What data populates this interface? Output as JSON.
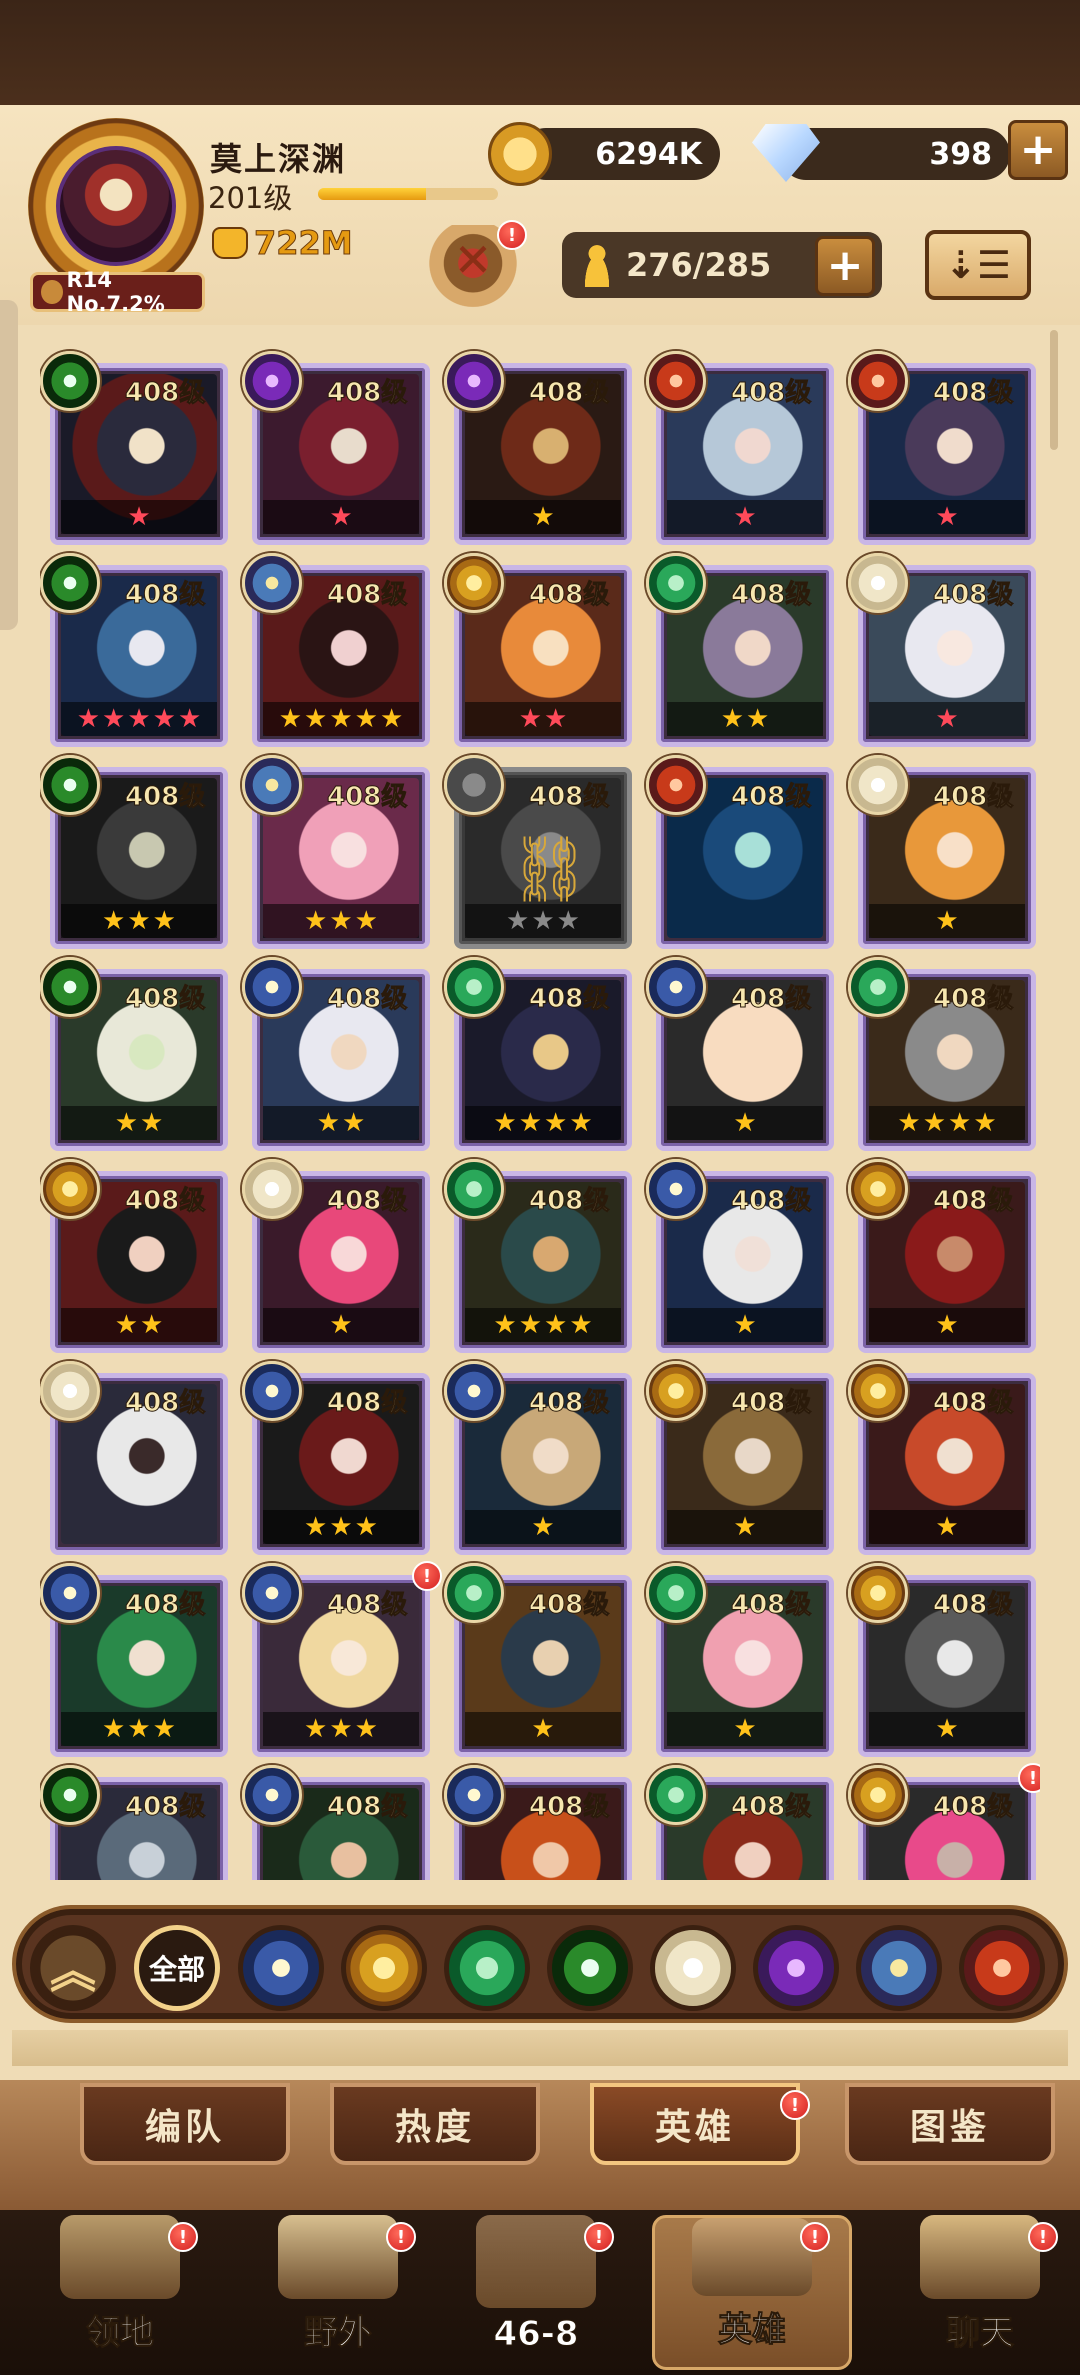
{
  "player": {
    "name": "莫上深渊",
    "level": "201级",
    "power": "722M",
    "rank_badge": "R14 No.7.2%",
    "xp_progress": 0.6
  },
  "currencies": {
    "gold": "6294K",
    "diamonds": "398"
  },
  "hero_capacity": "276/285",
  "notification_badge": "!",
  "heroes": [
    {
      "level": "408级",
      "faction": "graveborn",
      "stars": 1,
      "star_color": "red",
      "portrait": "p0"
    },
    {
      "level": "408级",
      "faction": "hypogean",
      "stars": 1,
      "star_color": "red",
      "portrait": "p1"
    },
    {
      "level": "408级",
      "faction": "hypogean",
      "stars": 1,
      "star_color": "gold",
      "portrait": "p2"
    },
    {
      "level": "408级",
      "faction": "draconis",
      "stars": 1,
      "star_color": "red",
      "portrait": "p3"
    },
    {
      "level": "408级",
      "faction": "draconis",
      "stars": 1,
      "star_color": "red",
      "portrait": "p4"
    },
    {
      "level": "408级",
      "faction": "graveborn",
      "stars": 5,
      "star_color": "red",
      "portrait": "p5"
    },
    {
      "level": "408级",
      "faction": "dimensional",
      "stars": 5,
      "star_color": "gold",
      "portrait": "p6"
    },
    {
      "level": "408级",
      "faction": "mauler",
      "stars": 2,
      "star_color": "red",
      "portrait": "p7"
    },
    {
      "level": "408级",
      "faction": "wilder",
      "stars": 2,
      "star_color": "gold",
      "portrait": "p8"
    },
    {
      "level": "408级",
      "faction": "celestial",
      "stars": 1,
      "star_color": "red",
      "portrait": "p9"
    },
    {
      "level": "408级",
      "faction": "graveborn",
      "stars": 3,
      "star_color": "gold",
      "portrait": "p10"
    },
    {
      "level": "408级",
      "faction": "dimensional",
      "stars": 3,
      "star_color": "gold",
      "portrait": "p11"
    },
    {
      "level": "408级",
      "faction": "locked",
      "stars": 3,
      "star_color": "grey",
      "portrait": "p12",
      "locked": true
    },
    {
      "level": "408级",
      "faction": "draconis",
      "stars": 0,
      "star_color": "gold",
      "portrait": "p13"
    },
    {
      "level": "408级",
      "faction": "celestial",
      "stars": 1,
      "star_color": "gold",
      "portrait": "p14"
    },
    {
      "level": "408级",
      "faction": "graveborn",
      "stars": 2,
      "star_color": "gold",
      "portrait": "p15"
    },
    {
      "level": "408级",
      "faction": "lightbearer",
      "stars": 2,
      "star_color": "gold",
      "portrait": "p16"
    },
    {
      "level": "408级",
      "faction": "wilder",
      "stars": 4,
      "star_color": "gold",
      "portrait": "p17"
    },
    {
      "level": "408级",
      "faction": "lightbearer",
      "stars": 1,
      "star_color": "gold",
      "portrait": "p18"
    },
    {
      "level": "408级",
      "faction": "wilder",
      "stars": 4,
      "star_color": "gold",
      "portrait": "p19"
    },
    {
      "level": "408级",
      "faction": "mauler",
      "stars": 2,
      "star_color": "gold",
      "portrait": "p20"
    },
    {
      "level": "408级",
      "faction": "celestial",
      "stars": 1,
      "star_color": "gold",
      "portrait": "p21"
    },
    {
      "level": "408级",
      "faction": "wilder",
      "stars": 4,
      "star_color": "gold",
      "portrait": "p22"
    },
    {
      "level": "408级",
      "faction": "lightbearer",
      "stars": 1,
      "star_color": "gold",
      "portrait": "p23"
    },
    {
      "level": "408级",
      "faction": "mauler",
      "stars": 1,
      "star_color": "gold",
      "portrait": "p24"
    },
    {
      "level": "408级",
      "faction": "celestial",
      "stars": 0,
      "star_color": "gold",
      "portrait": "p25"
    },
    {
      "level": "408级",
      "faction": "lightbearer",
      "stars": 3,
      "star_color": "gold",
      "portrait": "p26"
    },
    {
      "level": "408级",
      "faction": "lightbearer",
      "stars": 1,
      "star_color": "gold",
      "portrait": "p27"
    },
    {
      "level": "408级",
      "faction": "mauler",
      "stars": 1,
      "star_color": "gold",
      "portrait": "p28"
    },
    {
      "level": "408级",
      "faction": "mauler",
      "stars": 1,
      "star_color": "gold",
      "portrait": "p29"
    },
    {
      "level": "408级",
      "faction": "lightbearer",
      "stars": 3,
      "star_color": "gold",
      "portrait": "p30"
    },
    {
      "level": "408级",
      "faction": "lightbearer",
      "stars": 3,
      "star_color": "gold",
      "portrait": "p31",
      "badge": true
    },
    {
      "level": "408级",
      "faction": "wilder",
      "stars": 1,
      "star_color": "gold",
      "portrait": "p32"
    },
    {
      "level": "408级",
      "faction": "wilder",
      "stars": 1,
      "star_color": "gold",
      "portrait": "p33"
    },
    {
      "level": "408级",
      "faction": "mauler",
      "stars": 1,
      "star_color": "gold",
      "portrait": "p34"
    },
    {
      "level": "408级",
      "faction": "graveborn",
      "stars": 0,
      "star_color": "gold",
      "portrait": "p35"
    },
    {
      "level": "408级",
      "faction": "lightbearer",
      "stars": 0,
      "star_color": "gold",
      "portrait": "p36"
    },
    {
      "level": "408级",
      "faction": "lightbearer",
      "stars": 0,
      "star_color": "gold",
      "portrait": "p37"
    },
    {
      "level": "408级",
      "faction": "wilder",
      "stars": 0,
      "star_color": "gold",
      "portrait": "p38"
    },
    {
      "level": "408级",
      "faction": "mauler",
      "stars": 0,
      "star_color": "gold",
      "portrait": "p39",
      "badge": true
    }
  ],
  "filters": {
    "up_icon": "chevron-up-icon",
    "all_label": "全部",
    "factions": [
      "lightbearer",
      "mauler",
      "wilder",
      "graveborn",
      "celestial",
      "hypogean",
      "dimensional",
      "draconis"
    ]
  },
  "subtabs": [
    {
      "label": "编队",
      "active": false,
      "badge": false
    },
    {
      "label": "热度",
      "active": false,
      "badge": false
    },
    {
      "label": "英雄",
      "active": true,
      "badge": true
    },
    {
      "label": "图鉴",
      "active": false,
      "badge": false
    }
  ],
  "bottom_nav": [
    {
      "label": "领地",
      "icon": "castle-icon",
      "badge": true,
      "active": false
    },
    {
      "label": "野外",
      "icon": "map-scroll-icon",
      "badge": true,
      "active": false
    },
    {
      "label": "46-8",
      "icon": "crossed-swords-icon",
      "badge": true,
      "active": false
    },
    {
      "label": "英雄",
      "icon": "helmet-icon",
      "badge": true,
      "active": true
    },
    {
      "label": "聊天",
      "icon": "chat-bubble-icon",
      "badge": true,
      "active": false
    }
  ],
  "colors": {
    "accent_gold": "#e59a12",
    "card_border": "#c9b6e6",
    "badge_red": "#d32020"
  }
}
